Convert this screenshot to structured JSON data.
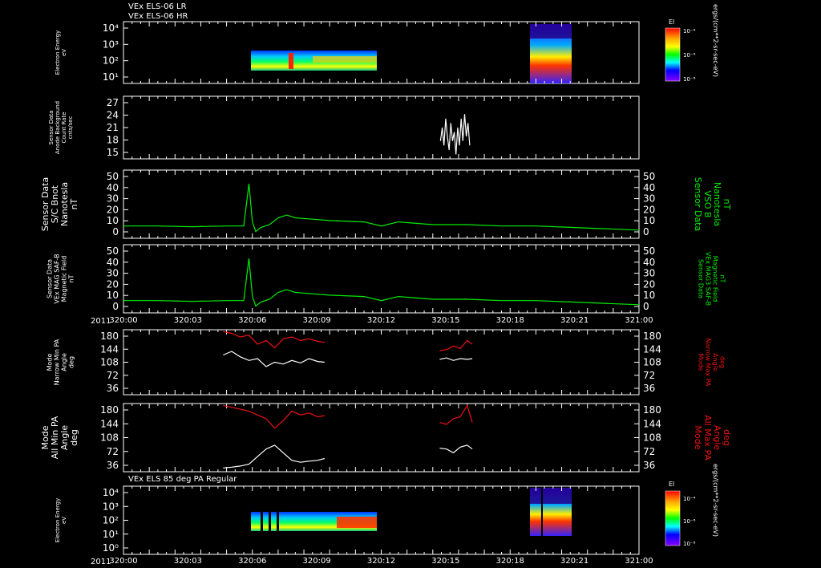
{
  "header": {
    "line1": "VEx ELS-06 LR",
    "line2": "VEx ELS-06 HR",
    "bottom_title": "VEx ELS 85 deg PA Regular",
    "year": "2011"
  },
  "colors": {
    "frame": "#ffffff",
    "green": "#00ee00",
    "red": "#ee1111",
    "white": "#ffffff"
  },
  "colorbars": [
    {
      "label": "El",
      "ticks": [
        "10⁻⁴",
        "10⁻⁶",
        "10⁻⁸"
      ],
      "unit": "ergs/(cm**2-sr-sec-eV)"
    },
    {
      "label": "El",
      "ticks": [
        "10⁻⁴",
        "10⁻⁶",
        "10⁻⁸"
      ],
      "unit": "ergs/(cm**2-sr-sec-eV)"
    }
  ],
  "x_ticks": [
    "320:00",
    "320:03",
    "320:06",
    "320:09",
    "320:12",
    "320:15",
    "320:18",
    "320:21",
    "321:00"
  ],
  "panels": {
    "p1": {
      "ylabel": [
        "Electron Energy",
        "eV"
      ],
      "ticks": [
        "10⁴",
        "10³",
        "10²",
        "10¹"
      ]
    },
    "p2": {
      "ylabel": [
        "Sensor Data",
        "Anode Background",
        "Count Rate",
        "cnts/sec"
      ],
      "ticks": [
        "27",
        "24",
        "21",
        "18",
        "15"
      ]
    },
    "p3": {
      "ylabel": [
        "Sensor Data",
        "S/C Bnot",
        "Nanotesla",
        "nT"
      ],
      "ylabel_right": [
        "Sensor Data",
        "VSO B",
        "Nanotesla",
        "nT"
      ],
      "ticks": [
        "50",
        "40",
        "30",
        "20",
        "10",
        "0"
      ]
    },
    "p4": {
      "ylabel": [
        "Sensor Data",
        "VEx MAG SAF-B",
        "Magnetic Field",
        "nT"
      ],
      "ylabel_right": [
        "Sensor Data",
        "VEx MAG3 SAF-B",
        "Magnetic Field",
        "nT"
      ],
      "ticks": [
        "50",
        "40",
        "30",
        "20",
        "10",
        "0"
      ]
    },
    "p5": {
      "ylabel": [
        "Mode",
        "Narrow Min PA",
        "Angle",
        "deg"
      ],
      "ylabel_right": [
        "Mode",
        "Narrow Max PA",
        "Angle",
        "deg"
      ],
      "ticks": [
        "180",
        "144",
        "108",
        "72",
        "36"
      ]
    },
    "p6": {
      "ylabel": [
        "Mode",
        "All Min PA",
        "Angle",
        "deg"
      ],
      "ylabel_right": [
        "Mode",
        "All Max PA",
        "Angle",
        "deg"
      ],
      "ticks": [
        "180",
        "144",
        "108",
        "72",
        "36"
      ]
    },
    "p7": {
      "ylabel": [
        "Electron Energy",
        "eV"
      ],
      "ticks": [
        "10⁴",
        "10³",
        "10²",
        "10¹",
        "10⁰"
      ]
    }
  },
  "chart_data": [
    {
      "type": "heatmap",
      "title": "VEx ELS-06 LR / VEx ELS-06 HR",
      "ylabel": "Electron Energy eV",
      "yscale": "log",
      "ylim": [
        10,
        10000
      ],
      "xlim": [
        "320:00",
        "321:00"
      ],
      "segments": [
        {
          "start": "320:05.8",
          "end": "320:11.7"
        },
        {
          "start": "320:18.4",
          "end": "320:20.3"
        }
      ]
    },
    {
      "type": "line",
      "ylabel": "Anode Background Count Rate cnts/sec",
      "ylim": [
        13,
        27
      ],
      "xlim": [
        "320:00",
        "321:00"
      ],
      "series": [
        {
          "color": "white",
          "x": [
            18.45,
            18.55,
            18.65,
            18.75,
            18.85,
            18.95,
            19.05,
            19.15,
            19.25,
            19.35,
            19.45,
            19.55,
            19.65,
            19.75,
            19.85,
            19.95,
            20.05,
            20.15
          ],
          "y": [
            17,
            20,
            16,
            22,
            18,
            15,
            21,
            17,
            19,
            14,
            20,
            16,
            22,
            17,
            23,
            18,
            21,
            16
          ]
        }
      ]
    },
    {
      "type": "line",
      "ylabel": "S/C Bnot nT",
      "ylim": [
        0,
        50
      ],
      "xlim": [
        "320:00",
        "321:00"
      ],
      "series": [
        {
          "color": "green",
          "x": [
            0,
            2,
            4,
            6,
            7,
            7.3,
            7.5,
            7.7,
            8,
            8.5,
            9,
            9.5,
            10,
            11,
            12,
            14,
            15,
            16,
            18,
            20,
            22,
            24,
            26,
            28,
            30
          ],
          "y": [
            9,
            9,
            8.5,
            9,
            9,
            40,
            12,
            5,
            8,
            10,
            15,
            17,
            15,
            14,
            13,
            12,
            9,
            12,
            10,
            10,
            9,
            9,
            8,
            7,
            6
          ]
        }
      ]
    },
    {
      "type": "line",
      "ylabel": "VEx MAG SAF-B nT",
      "ylim": [
        0,
        50
      ],
      "xlim": [
        "320:00",
        "321:00"
      ],
      "series": [
        {
          "color": "green",
          "x": [
            0,
            2,
            4,
            6,
            7,
            7.3,
            7.5,
            7.7,
            8,
            8.5,
            9,
            9.5,
            10,
            11,
            12,
            14,
            15,
            16,
            18,
            20,
            22,
            24,
            26,
            28,
            30
          ],
          "y": [
            9,
            9,
            8.5,
            9,
            9,
            40,
            12,
            5,
            8,
            10,
            15,
            17,
            15,
            14,
            13,
            12,
            9,
            12,
            10,
            10,
            9,
            9,
            8,
            7,
            6
          ]
        }
      ]
    },
    {
      "type": "line",
      "ylabel": "Narrow Min/Max PA deg",
      "ylim": [
        0,
        180
      ],
      "xlim": [
        "320:00",
        "321:00"
      ],
      "series": [
        {
          "color": "white",
          "x": [
            5.8,
            6.3,
            6.8,
            7.3,
            7.8,
            8.3,
            8.8,
            9.3,
            9.8,
            10.3,
            10.8,
            11.3,
            11.7
          ],
          "y": [
            110,
            120,
            105,
            95,
            100,
            78,
            90,
            85,
            95,
            88,
            100,
            92,
            90
          ]
        },
        {
          "color": "red",
          "x": [
            5.8,
            6.3,
            6.8,
            7.3,
            7.8,
            8.3,
            8.8,
            9.3,
            9.8,
            10.3,
            10.8,
            11.3,
            11.7
          ],
          "y": [
            175,
            170,
            160,
            165,
            140,
            150,
            130,
            155,
            160,
            150,
            155,
            148,
            145
          ]
        },
        {
          "color": "white",
          "x": [
            18.4,
            18.8,
            19.2,
            19.6,
            20.0,
            20.3
          ],
          "y": [
            98,
            102,
            95,
            100,
            98,
            100
          ]
        },
        {
          "color": "red",
          "x": [
            18.4,
            18.8,
            19.2,
            19.6,
            20.0,
            20.3
          ],
          "y": [
            122,
            125,
            135,
            128,
            150,
            140
          ]
        }
      ]
    },
    {
      "type": "line",
      "ylabel": "All Min/Max PA deg",
      "ylim": [
        0,
        180
      ],
      "xlim": [
        "320:00",
        "321:00"
      ],
      "series": [
        {
          "color": "white",
          "x": [
            5.8,
            6.3,
            6.8,
            7.3,
            7.8,
            8.3,
            8.8,
            9.3,
            9.8,
            10.3,
            10.8,
            11.3,
            11.7
          ],
          "y": [
            10,
            12,
            15,
            20,
            40,
            60,
            70,
            50,
            30,
            25,
            28,
            30,
            35
          ]
        },
        {
          "color": "red",
          "x": [
            5.8,
            6.3,
            6.8,
            7.3,
            7.8,
            8.3,
            8.8,
            9.3,
            9.8,
            10.3,
            10.8,
            11.3,
            11.7
          ],
          "y": [
            175,
            170,
            165,
            160,
            150,
            140,
            115,
            135,
            160,
            150,
            155,
            145,
            148
          ]
        },
        {
          "color": "white",
          "x": [
            18.4,
            18.8,
            19.2,
            19.6,
            20.0,
            20.3
          ],
          "y": [
            62,
            60,
            50,
            65,
            70,
            60
          ]
        },
        {
          "color": "red",
          "x": [
            18.4,
            18.8,
            19.2,
            19.6,
            20.0,
            20.3
          ],
          "y": [
            130,
            125,
            140,
            145,
            175,
            130
          ]
        }
      ]
    },
    {
      "type": "heatmap",
      "title": "VEx ELS 85 deg PA Regular",
      "ylabel": "Electron Energy eV",
      "yscale": "log",
      "ylim": [
        1,
        10000
      ],
      "xlim": [
        "320:00",
        "321:00"
      ],
      "segments": [
        {
          "start": "320:05.8",
          "end": "320:11.7"
        },
        {
          "start": "320:18.4",
          "end": "320:20.3"
        }
      ]
    }
  ]
}
